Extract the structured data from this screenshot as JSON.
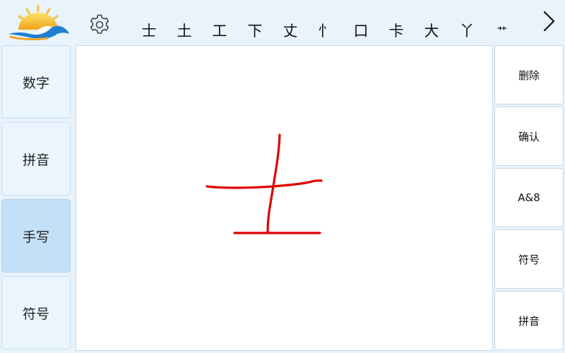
{
  "toolbar": {
    "logo_icon": "sun-cloud-logo-icon",
    "settings_icon": "gear-icon",
    "candidates": [
      "士",
      "土",
      "工",
      "下",
      "丈",
      "忄",
      "口",
      "卡",
      "大",
      "丫",
      "艹"
    ],
    "next_icon": "chevron-right-icon"
  },
  "modes": {
    "items": [
      "数字",
      "拼音",
      "手写",
      "符号"
    ],
    "active": "手写"
  },
  "actions": {
    "delete_label": "删除",
    "confirm_label": "确认",
    "alnum_label": "A&8",
    "symbol_label": "符号",
    "pinyin_label": "拼音"
  },
  "colors": {
    "stroke": "#e00000",
    "active_mode": "#c3e0f6",
    "background": "#e8f3fc"
  }
}
